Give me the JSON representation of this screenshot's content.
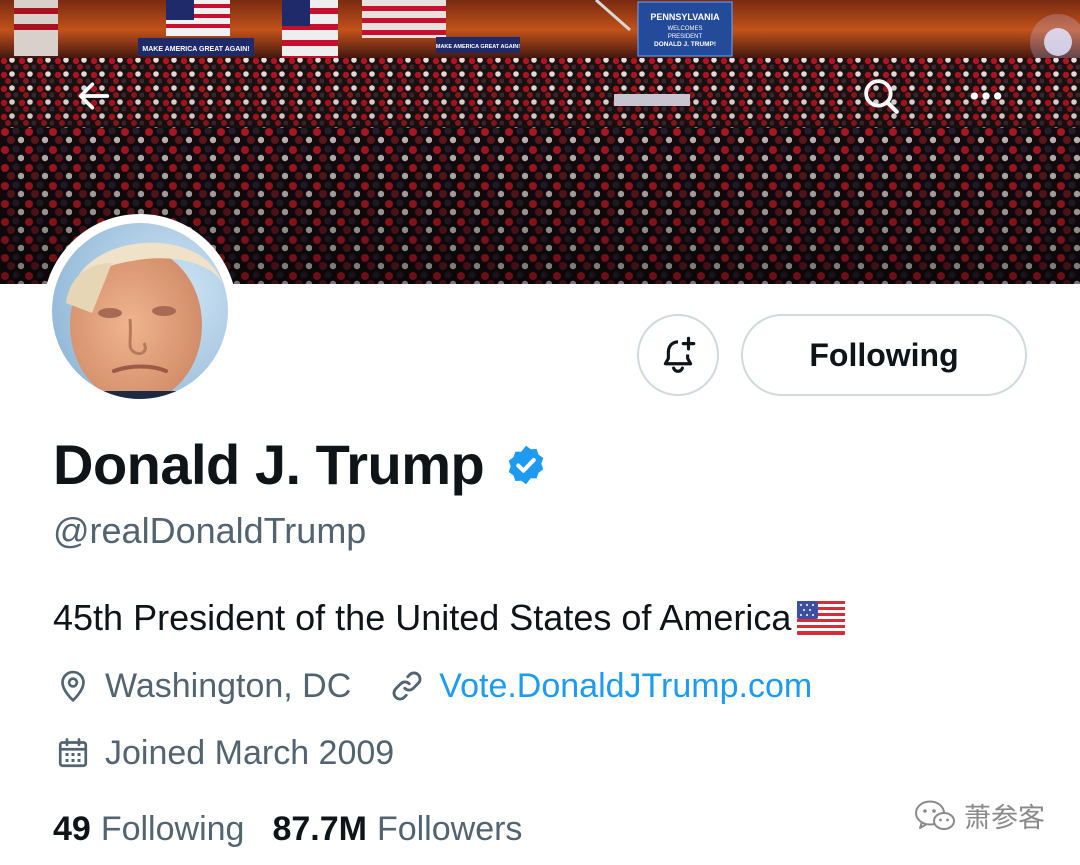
{
  "banner": {
    "signs": [
      "MAKE AMERICA GREAT AGAIN!",
      "MAKE AMERICA GREAT AGAIN!"
    ],
    "stage_sign": [
      "PENNSYLVANIA",
      "WELCOMES",
      "PRESIDENT",
      "DONALD J. TRUMP!"
    ],
    "icons": {
      "back": "arrow-left-icon",
      "search": "search-icon",
      "more": "more-horizontal-icon"
    }
  },
  "profile": {
    "display_name": "Donald J. Trump",
    "handle": "@realDonaldTrump",
    "verified": true,
    "bio": "45th President of the United States of America",
    "location": "Washington, DC",
    "website": "Vote.DonaldJTrump.com",
    "joined": "Joined March 2009"
  },
  "actions": {
    "notify_icon": "bell-plus-icon",
    "following_label": "Following"
  },
  "stats": {
    "following_count": "49",
    "following_label": "Following",
    "followers_count": "87.7M",
    "followers_label": "Followers"
  },
  "watermark": {
    "text": "萧参客"
  },
  "colors": {
    "accent": "#1d9bf0",
    "text_primary": "#0f1419",
    "text_secondary": "#536471",
    "border": "#cfd9de"
  }
}
